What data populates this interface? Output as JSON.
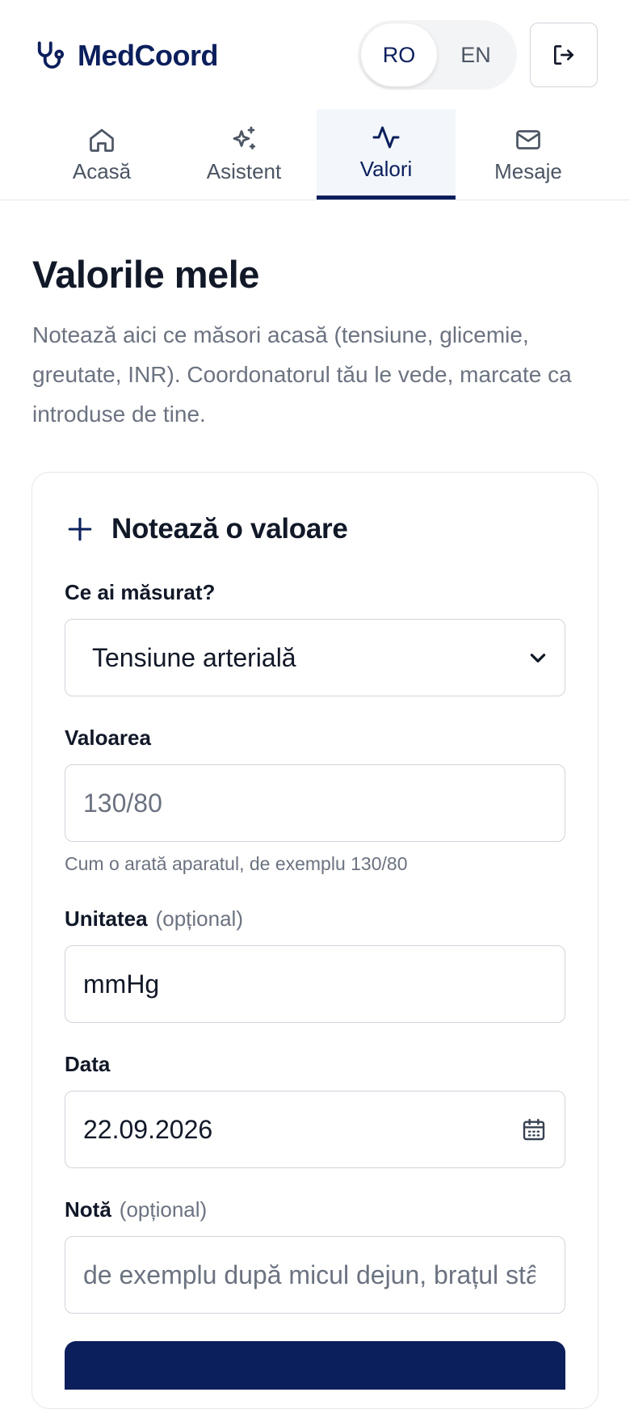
{
  "app": {
    "name": "MedCoord"
  },
  "language": {
    "options": [
      "RO",
      "EN"
    ],
    "selected": "RO"
  },
  "nav": {
    "tabs": [
      {
        "label": "Acasă",
        "icon": "home-icon"
      },
      {
        "label": "Asistent",
        "icon": "sparkles-icon"
      },
      {
        "label": "Valori",
        "icon": "activity-icon",
        "active": true
      },
      {
        "label": "Mesaje",
        "icon": "mail-icon"
      }
    ]
  },
  "page": {
    "title": "Valorile mele",
    "intro": "Notează aici ce măsori acasă (tensiune, glicemie, greutate, INR). Coordonatorul tău le vede, marcate ca introduse de tine."
  },
  "form": {
    "title": "Notează o valoare",
    "measure": {
      "label": "Ce ai măsurat?",
      "selected": "Tensiune arterială"
    },
    "value": {
      "label": "Valoarea",
      "placeholder": "130/80",
      "hint": "Cum o arată aparatul, de exemplu 130/80"
    },
    "unit": {
      "label": "Unitatea",
      "optional": "(opțional)",
      "value": "mmHg"
    },
    "date": {
      "label": "Data",
      "value": "22.09.2026"
    },
    "note": {
      "label": "Notă",
      "optional": "(opțional)",
      "placeholder": "de exemplu după micul dejun, brațul stâ"
    }
  },
  "colors": {
    "brand": "#0b1f5c",
    "muted": "#6b7280",
    "border": "#d1d5db"
  }
}
